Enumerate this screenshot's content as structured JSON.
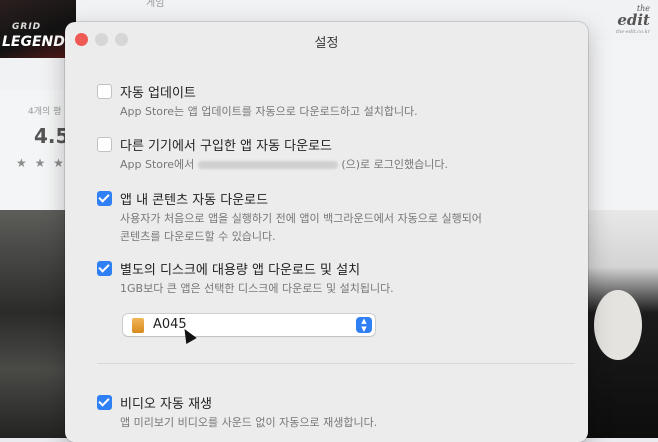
{
  "background": {
    "game_logo_top": "GRID",
    "game_logo_bottom": "LEGENDS",
    "ratings_count_label": "4개의 평",
    "rating_value": "4.5",
    "stars": "★ ★ ★",
    "top_text": "게임",
    "watermark": {
      "line1": "the",
      "line2": "edit",
      "line3": "the-edit.co.kr"
    }
  },
  "window": {
    "title": "설정",
    "options": [
      {
        "label": "자동 업데이트",
        "desc": "App Store는 앱 업데이트를 자동으로 다운로드하고 설치합니다.",
        "checked": false
      },
      {
        "label": "다른 기기에서 구입한 앱 자동 다운로드",
        "desc_prefix": "App Store에서",
        "desc_suffix": "(으)로 로그인했습니다.",
        "checked": false
      },
      {
        "label": "앱 내 콘텐츠 자동 다운로드",
        "desc_line1": "사용자가 처음으로 앱을 실행하기 전에 앱이 백그라운드에서 자동으로 실행되어",
        "desc_line2": "콘텐츠를 다운로드할 수 있습니다.",
        "checked": true
      },
      {
        "label": "별도의 디스크에 대용량 앱 다운로드 및 설치",
        "desc": "1GB보다 큰 앱은 선택한 디스크에 다운로드 및 설치됩니다.",
        "checked": true
      },
      {
        "label": "비디오 자동 재생",
        "desc": "앱 미리보기 비디오를 사운드 없이 자동으로 재생합니다.",
        "checked": true
      }
    ],
    "disk_select": {
      "value": "A045"
    }
  },
  "colors": {
    "accent": "#2f7ff5",
    "close": "#ee5b55"
  },
  "icons": [
    "close-icon",
    "disk-icon",
    "updown-chevron-icon",
    "cursor-icon",
    "checkmark-icon"
  ]
}
